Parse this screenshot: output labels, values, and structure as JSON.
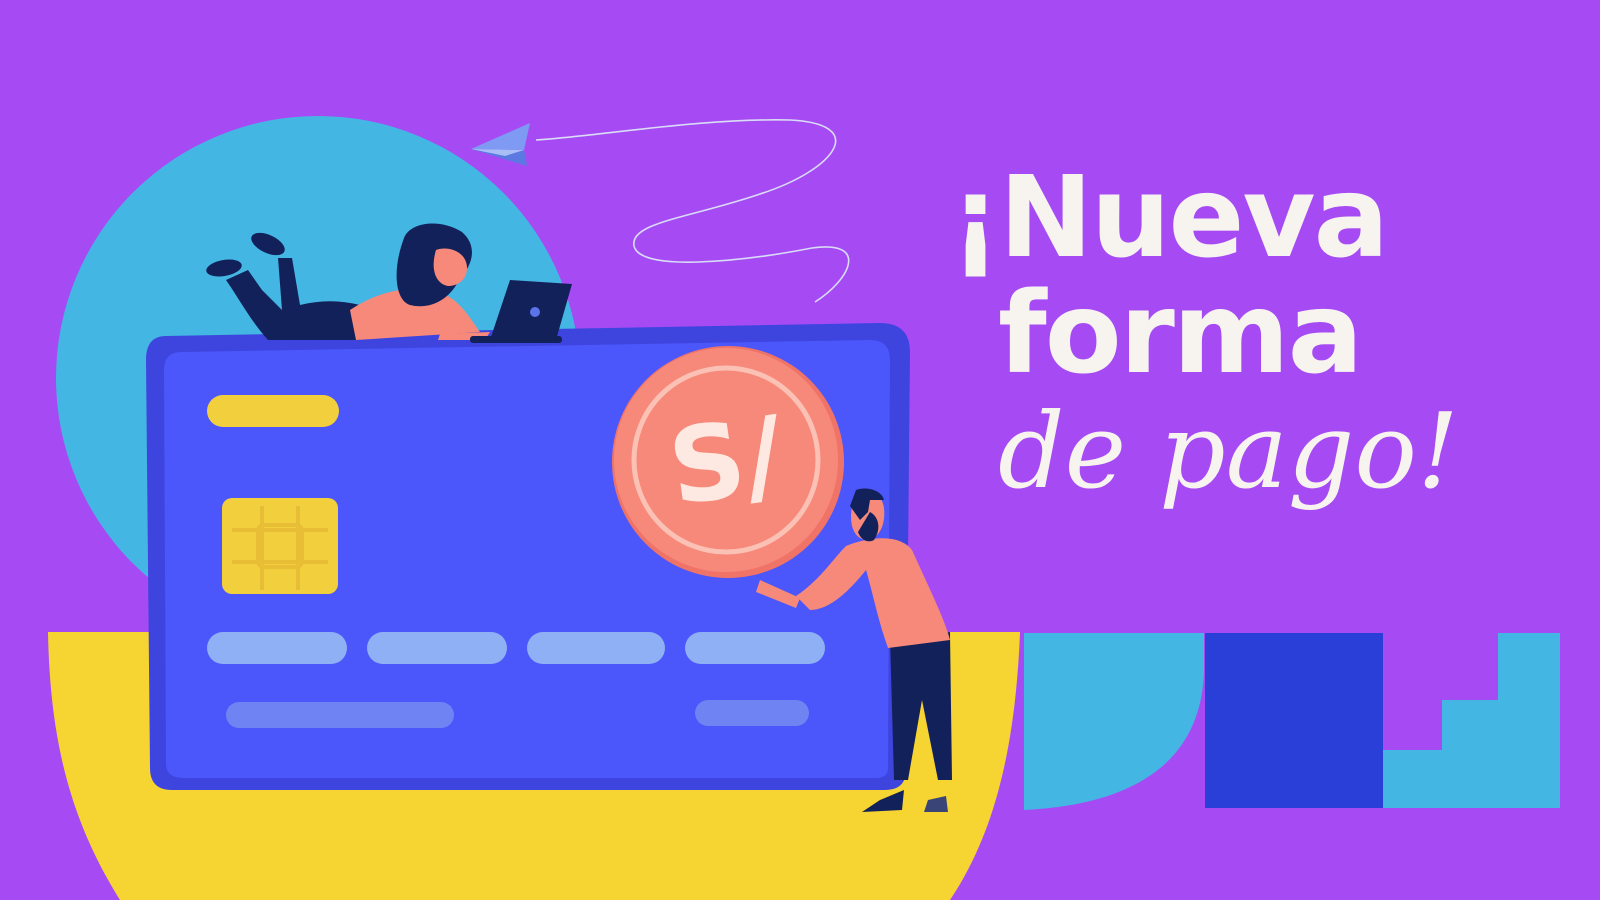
{
  "headline": {
    "line1": "¡Nueva",
    "line2": "forma",
    "line3": "de pago!"
  },
  "coin": {
    "symbol": "S/"
  },
  "colors": {
    "background": "#a64bf4",
    "circle": "#44b6e3",
    "floor": "#f6d533",
    "card": "#4b56fb",
    "card_border": "#3e45de",
    "chip": "#f2cf3c",
    "coin": "#f7897a",
    "skin_shirt": "#f7897a",
    "navy": "#13215a",
    "block_dark": "#2a3fd8",
    "block_light": "#44b6e3",
    "headline_text": "#f7f4f0"
  },
  "icons": [
    "paper-plane-icon",
    "credit-card-chip-icon",
    "coin-icon",
    "laptop-icon"
  ]
}
